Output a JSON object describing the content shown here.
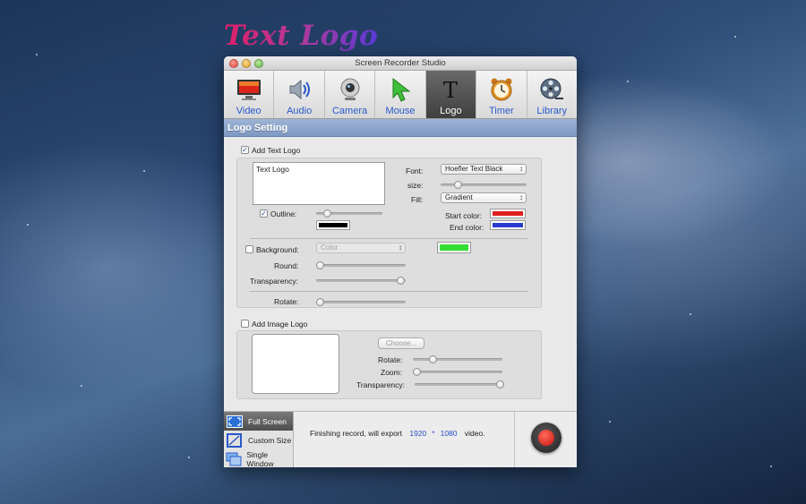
{
  "desktop": {
    "overlay_logo_text": "Text Logo"
  },
  "window": {
    "title": "Screen Recorder Studio",
    "toolbar": [
      {
        "label": "Video",
        "icon": "video-icon"
      },
      {
        "label": "Audio",
        "icon": "audio-icon"
      },
      {
        "label": "Camera",
        "icon": "camera-icon"
      },
      {
        "label": "Mouse",
        "icon": "mouse-cursor-icon"
      },
      {
        "label": "Logo",
        "icon": "logo-t-icon",
        "active": true
      },
      {
        "label": "Timer",
        "icon": "alarm-clock-icon"
      },
      {
        "label": "Library",
        "icon": "film-reel-icon"
      }
    ],
    "section_title": "Logo Setting"
  },
  "text_logo": {
    "enabled_label": "Add Text Logo",
    "enabled": true,
    "text_value": "Text Logo",
    "font_label": "Font:",
    "font_value": "Hoefler Text Black",
    "size_label": "size:",
    "fill_label": "Fill:",
    "fill_value": "Gradient",
    "outline_label": "Outline:",
    "outline_enabled": true,
    "outline_color": "#000000",
    "start_color_label": "Start color:",
    "start_color": "#e02020",
    "end_color_label": "End color:",
    "end_color": "#2a3ccf",
    "background_label": "Background:",
    "background_enabled": false,
    "background_select_value": "Color",
    "background_color": "#33dd33",
    "round_label": "Round:",
    "transparency_label": "Transparency:",
    "rotate_label": "Rotate:"
  },
  "image_logo": {
    "enabled_label": "Add Image Logo",
    "enabled": false,
    "choose_label": "Choose...",
    "rotate_label": "Rotate:",
    "zoom_label": "Zoom:",
    "transparency_label": "Transparency:"
  },
  "bottom": {
    "modes": [
      {
        "label": "Full Screen",
        "icon": "full-screen-icon",
        "active": true
      },
      {
        "label": "Custom Size",
        "icon": "custom-size-icon"
      },
      {
        "label": "Single Window",
        "icon": "single-window-icon"
      }
    ],
    "status_prefix": "Finishing record, will export",
    "width": "1920",
    "separator": "*",
    "height": "1080",
    "status_suffix": "video."
  }
}
